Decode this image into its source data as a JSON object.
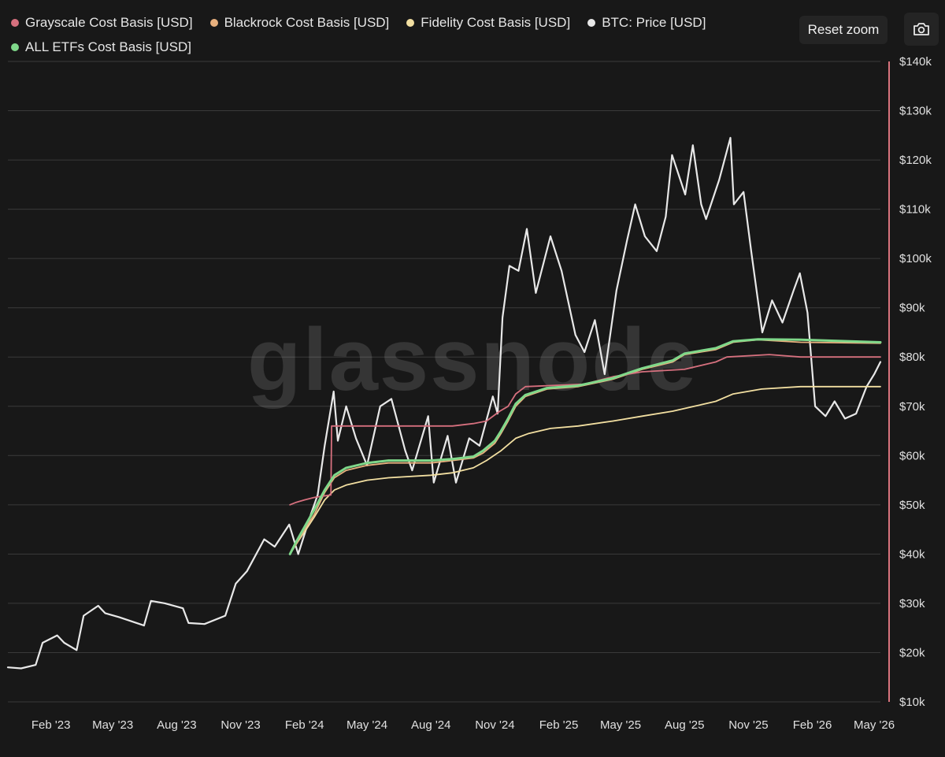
{
  "toolbar": {
    "reset_label": "Reset zoom",
    "camera_icon": "camera-icon"
  },
  "watermark": "glassnode",
  "colors": {
    "background": "#181818",
    "grid": "#3a3a3a",
    "right_axis": "#d9737d",
    "grayscale": "#d6707e",
    "blackrock": "#e8b07e",
    "fidelity": "#f2dfa1",
    "btc": "#e8e8e8",
    "all_etfs": "#7fd88a"
  },
  "chart_data": {
    "type": "line",
    "title": "",
    "xlabel": "",
    "ylabel": "",
    "ylim": [
      10000,
      140000
    ],
    "xlim": [
      "2022-12-01",
      "2026-05-10"
    ],
    "grid": true,
    "legend_position": "top-left",
    "x_tick_labels": [
      {
        "date": "2023-02-01",
        "label": "Feb '23"
      },
      {
        "date": "2023-05-01",
        "label": "May '23"
      },
      {
        "date": "2023-08-01",
        "label": "Aug '23"
      },
      {
        "date": "2023-11-01",
        "label": "Nov '23"
      },
      {
        "date": "2024-02-01",
        "label": "Feb '24"
      },
      {
        "date": "2024-05-01",
        "label": "May '24"
      },
      {
        "date": "2024-08-01",
        "label": "Aug '24"
      },
      {
        "date": "2024-11-01",
        "label": "Nov '24"
      },
      {
        "date": "2025-02-01",
        "label": "Feb '25"
      },
      {
        "date": "2025-05-01",
        "label": "May '25"
      },
      {
        "date": "2025-08-01",
        "label": "Aug '25"
      },
      {
        "date": "2025-11-01",
        "label": "Nov '25"
      },
      {
        "date": "2026-02-01",
        "label": "Feb '26"
      },
      {
        "date": "2026-05-01",
        "label": "May '26"
      }
    ],
    "y_tick_labels": [
      {
        "value": 10000,
        "label": "$10k"
      },
      {
        "value": 20000,
        "label": "$20k"
      },
      {
        "value": 30000,
        "label": "$30k"
      },
      {
        "value": 40000,
        "label": "$40k"
      },
      {
        "value": 50000,
        "label": "$50k"
      },
      {
        "value": 60000,
        "label": "$60k"
      },
      {
        "value": 70000,
        "label": "$70k"
      },
      {
        "value": 80000,
        "label": "$80k"
      },
      {
        "value": 90000,
        "label": "$90k"
      },
      {
        "value": 100000,
        "label": "$100k"
      },
      {
        "value": 110000,
        "label": "$110k"
      },
      {
        "value": 120000,
        "label": "$120k"
      },
      {
        "value": 130000,
        "label": "$130k"
      },
      {
        "value": 140000,
        "label": "$140k"
      }
    ],
    "series": [
      {
        "key": "grayscale",
        "name": "Grayscale Cost Basis [USD]",
        "x": [
          "2024-01-11",
          "2024-01-20",
          "2024-02-01",
          "2024-02-15",
          "2024-03-10",
          "2024-03-11",
          "2024-05-01",
          "2024-09-01",
          "2024-10-01",
          "2024-10-20",
          "2024-11-08",
          "2024-11-20",
          "2024-12-01",
          "2024-12-15",
          "2025-03-10",
          "2025-04-20",
          "2025-06-01",
          "2025-08-01",
          "2025-09-15",
          "2025-10-01",
          "2025-12-01",
          "2026-01-15",
          "2026-05-10"
        ],
        "values": [
          50000,
          50500,
          51000,
          51500,
          52000,
          66000,
          66000,
          66000,
          66500,
          67000,
          69000,
          70000,
          72500,
          74000,
          74500,
          76000,
          77000,
          77500,
          79000,
          80000,
          80500,
          80000,
          80000
        ]
      },
      {
        "key": "blackrock",
        "name": "Blackrock Cost Basis [USD]",
        "x": [
          "2024-01-11",
          "2024-01-20",
          "2024-02-01",
          "2024-02-15",
          "2024-03-01",
          "2024-03-15",
          "2024-04-01",
          "2024-05-01",
          "2024-06-01",
          "2024-08-01",
          "2024-09-01",
          "2024-10-01",
          "2024-10-15",
          "2024-11-01",
          "2024-11-10",
          "2024-11-20",
          "2024-12-01",
          "2024-12-15",
          "2025-01-15",
          "2025-03-01",
          "2025-04-20",
          "2025-06-01",
          "2025-07-15",
          "2025-08-01",
          "2025-09-15",
          "2025-10-10",
          "2025-11-15",
          "2026-01-15",
          "2026-05-10"
        ],
        "values": [
          40000,
          42000,
          45000,
          48000,
          52500,
          55500,
          57000,
          58000,
          58500,
          58500,
          59000,
          59500,
          60500,
          62500,
          64500,
          67000,
          70000,
          72000,
          73500,
          74000,
          75500,
          77500,
          79000,
          80500,
          81500,
          83000,
          83500,
          83000,
          82800
        ]
      },
      {
        "key": "fidelity",
        "name": "Fidelity Cost Basis [USD]",
        "x": [
          "2024-01-11",
          "2024-01-20",
          "2024-02-01",
          "2024-02-15",
          "2024-03-01",
          "2024-03-15",
          "2024-04-01",
          "2024-05-01",
          "2024-06-01",
          "2024-08-01",
          "2024-09-01",
          "2024-10-01",
          "2024-10-20",
          "2024-11-10",
          "2024-12-01",
          "2024-12-20",
          "2025-01-20",
          "2025-03-01",
          "2025-04-20",
          "2025-06-01",
          "2025-07-15",
          "2025-08-15",
          "2025-09-15",
          "2025-10-10",
          "2025-11-20",
          "2026-01-15",
          "2026-05-10"
        ],
        "values": [
          40000,
          42000,
          44500,
          47500,
          51000,
          53000,
          54000,
          55000,
          55500,
          56000,
          56500,
          57500,
          59000,
          61000,
          63500,
          64500,
          65500,
          66000,
          67000,
          68000,
          69000,
          70000,
          71000,
          72500,
          73500,
          74000,
          74000
        ]
      },
      {
        "key": "btc",
        "name": "BTC: Price [USD]",
        "x": [
          "2022-12-01",
          "2022-12-20",
          "2023-01-10",
          "2023-01-20",
          "2023-02-10",
          "2023-02-20",
          "2023-03-10",
          "2023-03-20",
          "2023-04-10",
          "2023-04-20",
          "2023-05-10",
          "2023-06-15",
          "2023-06-25",
          "2023-07-15",
          "2023-08-10",
          "2023-08-18",
          "2023-09-10",
          "2023-10-10",
          "2023-10-25",
          "2023-11-10",
          "2023-12-05",
          "2023-12-20",
          "2024-01-10",
          "2024-01-23",
          "2024-02-10",
          "2024-02-20",
          "2024-03-01",
          "2024-03-14",
          "2024-03-20",
          "2024-04-01",
          "2024-04-15",
          "2024-05-01",
          "2024-05-20",
          "2024-06-05",
          "2024-06-25",
          "2024-07-05",
          "2024-07-28",
          "2024-08-05",
          "2024-08-25",
          "2024-09-06",
          "2024-09-25",
          "2024-10-10",
          "2024-10-29",
          "2024-11-05",
          "2024-11-12",
          "2024-11-22",
          "2024-12-05",
          "2024-12-17",
          "2024-12-30",
          "2025-01-20",
          "2025-02-05",
          "2025-02-25",
          "2025-03-10",
          "2025-03-25",
          "2025-04-08",
          "2025-04-25",
          "2025-05-10",
          "2025-05-22",
          "2025-06-05",
          "2025-06-22",
          "2025-07-05",
          "2025-07-14",
          "2025-08-02",
          "2025-08-13",
          "2025-08-25",
          "2025-09-01",
          "2025-09-20",
          "2025-10-06",
          "2025-10-11",
          "2025-10-25",
          "2025-11-05",
          "2025-11-21",
          "2025-12-05",
          "2025-12-20",
          "2026-01-05",
          "2026-01-14",
          "2026-01-25",
          "2026-02-05",
          "2026-02-20",
          "2026-03-05",
          "2026-03-20",
          "2026-04-05",
          "2026-04-20",
          "2026-05-01",
          "2026-05-10"
        ],
        "values": [
          17000,
          16800,
          17500,
          22000,
          23500,
          22000,
          20500,
          27500,
          29500,
          28000,
          27200,
          25500,
          30500,
          30000,
          29000,
          26000,
          25800,
          27500,
          34000,
          36500,
          43000,
          41500,
          46000,
          40000,
          48000,
          52000,
          62000,
          73000,
          63000,
          70000,
          63500,
          58000,
          70000,
          71500,
          61000,
          57000,
          68000,
          54500,
          64000,
          54500,
          63500,
          62000,
          72000,
          68500,
          88000,
          98500,
          97500,
          106000,
          93000,
          104500,
          97500,
          84500,
          81000,
          87500,
          76500,
          93500,
          103500,
          111000,
          104500,
          101500,
          108500,
          121000,
          113000,
          123000,
          111000,
          108000,
          116000,
          124500,
          111000,
          113500,
          101500,
          85000,
          91500,
          87000,
          93500,
          97000,
          89000,
          70000,
          68000,
          71000,
          67500,
          68500,
          74000,
          76500,
          79000
        ]
      },
      {
        "key": "all_etfs",
        "name": "ALL ETFs Cost Basis [USD]",
        "x": [
          "2024-01-11",
          "2024-01-20",
          "2024-02-01",
          "2024-02-15",
          "2024-03-01",
          "2024-03-15",
          "2024-04-01",
          "2024-05-01",
          "2024-06-01",
          "2024-08-01",
          "2024-09-01",
          "2024-10-01",
          "2024-10-15",
          "2024-11-01",
          "2024-11-10",
          "2024-11-20",
          "2024-12-01",
          "2024-12-15",
          "2025-01-15",
          "2025-03-01",
          "2025-04-20",
          "2025-06-01",
          "2025-07-15",
          "2025-08-01",
          "2025-09-15",
          "2025-10-10",
          "2025-11-15",
          "2026-01-15",
          "2026-05-10"
        ],
        "values": [
          40000,
          42500,
          45500,
          49000,
          53000,
          56000,
          57500,
          58500,
          59000,
          59000,
          59300,
          59800,
          61000,
          63000,
          65000,
          67500,
          70500,
          72300,
          73700,
          74200,
          75700,
          77700,
          79300,
          80700,
          81800,
          83200,
          83600,
          83500,
          83000
        ]
      }
    ]
  }
}
